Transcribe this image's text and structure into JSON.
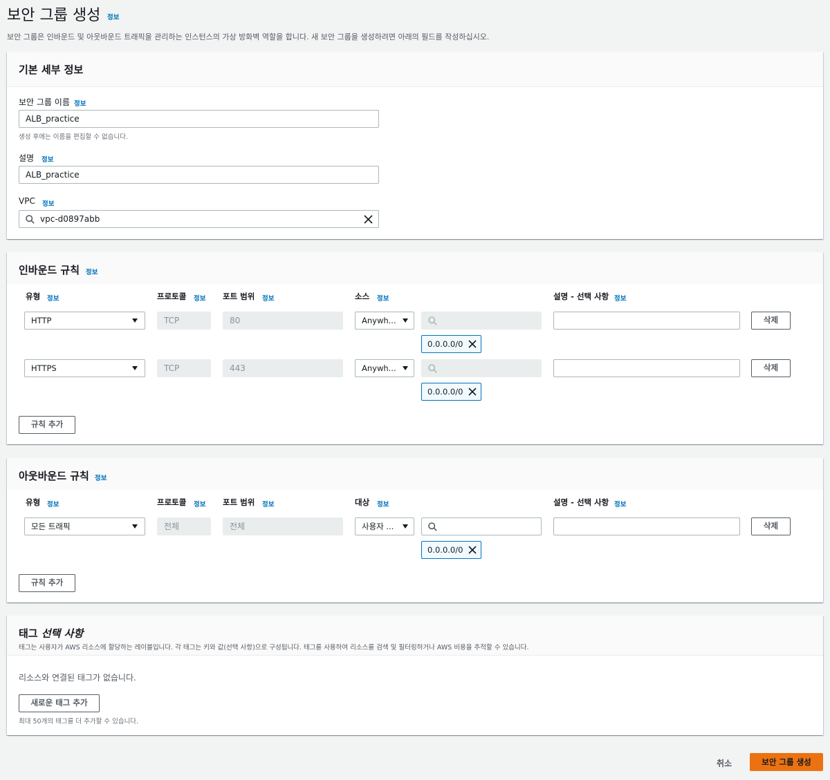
{
  "page": {
    "title": "보안 그룹 생성",
    "info": "정보",
    "description": "보안 그룹은 인바운드 및 아웃바운드 트래픽을 관리하는 인스턴스의 가상 방화벽 역할을 합니다. 새 보안 그룹을 생성하려면 아래의 필드를 작성하십시오."
  },
  "basic": {
    "title": "기본 세부 정보",
    "name_label": "보안 그룹 이름",
    "name_value": "ALB_practice",
    "name_hint": "생성 후에는 이름을 편집할 수 없습니다.",
    "desc_label": "설명",
    "desc_value": "ALB_practice",
    "vpc_label": "VPC",
    "vpc_value": "vpc-d0897abb"
  },
  "inbound": {
    "title": "인바운드 규칙",
    "columns": {
      "type": "유형",
      "protocol": "프로토콜",
      "port": "포트 범위",
      "source": "소스",
      "desc": "설명 - 선택 사항"
    },
    "rules": [
      {
        "type": "HTTP",
        "protocol": "TCP",
        "port": "80",
        "source": "Anywh...",
        "cidr": "0.0.0.0/0",
        "delete": "삭제"
      },
      {
        "type": "HTTPS",
        "protocol": "TCP",
        "port": "443",
        "source": "Anywh...",
        "cidr": "0.0.0.0/0",
        "delete": "삭제"
      }
    ],
    "add_rule": "규칙 추가"
  },
  "outbound": {
    "title": "아웃바운드 규칙",
    "columns": {
      "type": "유형",
      "protocol": "프로토콜",
      "port": "포트 범위",
      "dest": "대상",
      "desc": "설명 - 선택 사항"
    },
    "rules": [
      {
        "type": "모든 트래픽",
        "protocol": "전체",
        "port": "전체",
        "dest": "사용자 ...",
        "cidr": "0.0.0.0/0",
        "delete": "삭제"
      }
    ],
    "add_rule": "규칙 추가"
  },
  "tags": {
    "title": "태그",
    "title_optional": "선택 사항",
    "description": "태그는 사용자가 AWS 리소스에 할당하는 레이블입니다. 각 태그는 키와 값(선택 사항)으로 구성됩니다. 태그를 사용하여 리소스를 검색 및 필터링하거나 AWS 비용을 추적할 수 있습니다.",
    "empty": "리소스와 연결된 태그가 없습니다.",
    "add_tag": "새로운 태그 추가",
    "limit_hint": "최대 50개의 태그를 더 추가할 수 있습니다."
  },
  "footer": {
    "cancel": "취소",
    "create": "보안 그룹 생성"
  },
  "colors": {
    "link": "#0073bb",
    "primary": "#ec7211",
    "token_bg": "#f1faff"
  }
}
